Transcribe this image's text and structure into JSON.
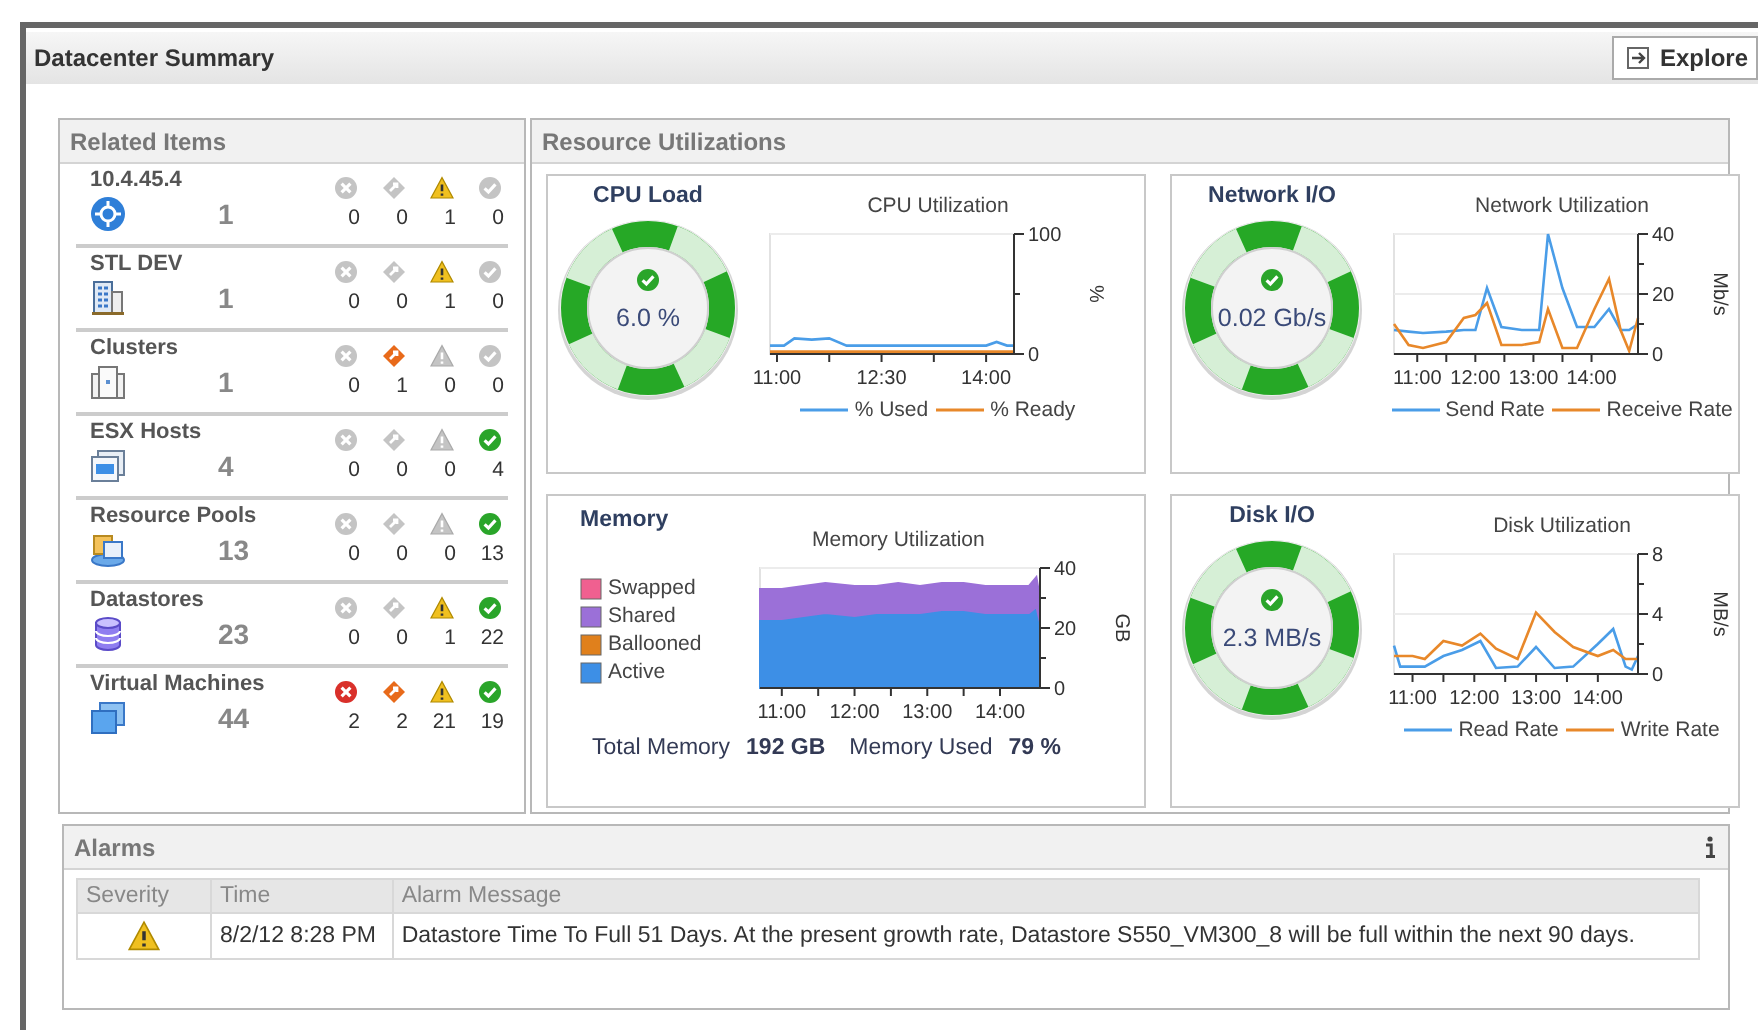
{
  "window": {
    "title": "Datacenter Summary"
  },
  "explore_button": {
    "label": "Explore"
  },
  "related_items": {
    "title": "Related Items",
    "items": [
      {
        "name": "10.4.45.4",
        "kind": "vcenter",
        "count": "1",
        "statuses": [
          {
            "kind": "critical",
            "count": "0",
            "active": false
          },
          {
            "kind": "major",
            "count": "0",
            "active": false
          },
          {
            "kind": "warning",
            "count": "1",
            "active": true
          },
          {
            "kind": "normal",
            "count": "0",
            "active": false
          }
        ]
      },
      {
        "name": "STL DEV",
        "kind": "datacenter",
        "count": "1",
        "statuses": [
          {
            "kind": "critical",
            "count": "0",
            "active": false
          },
          {
            "kind": "major",
            "count": "0",
            "active": false
          },
          {
            "kind": "warning",
            "count": "1",
            "active": true
          },
          {
            "kind": "normal",
            "count": "0",
            "active": false
          }
        ]
      },
      {
        "name": "Clusters",
        "kind": "cluster",
        "count": "1",
        "statuses": [
          {
            "kind": "critical",
            "count": "0",
            "active": false
          },
          {
            "kind": "major",
            "count": "1",
            "active": true
          },
          {
            "kind": "warning",
            "count": "0",
            "active": false
          },
          {
            "kind": "normal",
            "count": "0",
            "active": false
          }
        ]
      },
      {
        "name": "ESX Hosts",
        "kind": "host",
        "count": "4",
        "statuses": [
          {
            "kind": "critical",
            "count": "0",
            "active": false
          },
          {
            "kind": "major",
            "count": "0",
            "active": false
          },
          {
            "kind": "warning",
            "count": "0",
            "active": false
          },
          {
            "kind": "normal",
            "count": "4",
            "active": true
          }
        ]
      },
      {
        "name": "Resource Pools",
        "kind": "pool",
        "count": "13",
        "statuses": [
          {
            "kind": "critical",
            "count": "0",
            "active": false
          },
          {
            "kind": "major",
            "count": "0",
            "active": false
          },
          {
            "kind": "warning",
            "count": "0",
            "active": false
          },
          {
            "kind": "normal",
            "count": "13",
            "active": true
          }
        ]
      },
      {
        "name": "Datastores",
        "kind": "datastore",
        "count": "23",
        "statuses": [
          {
            "kind": "critical",
            "count": "0",
            "active": false
          },
          {
            "kind": "major",
            "count": "0",
            "active": false
          },
          {
            "kind": "warning",
            "count": "1",
            "active": true
          },
          {
            "kind": "normal",
            "count": "22",
            "active": true
          }
        ]
      },
      {
        "name": "Virtual Machines",
        "kind": "vm",
        "count": "44",
        "statuses": [
          {
            "kind": "critical",
            "count": "2",
            "active": true
          },
          {
            "kind": "major",
            "count": "2",
            "active": true
          },
          {
            "kind": "warning",
            "count": "21",
            "active": true
          },
          {
            "kind": "normal",
            "count": "19",
            "active": true
          }
        ]
      }
    ]
  },
  "resource_utilizations": {
    "title": "Resource Utilizations",
    "cards": [
      {
        "kind": "gauge",
        "title": "CPU Load",
        "value": "6.0 %",
        "healthy": true,
        "chart_data": {
          "type": "line",
          "title": "CPU Utilization",
          "ylabel": "%",
          "x": [
            10.9,
            11.1,
            11.25,
            11.5,
            11.75,
            12,
            12.5,
            13,
            13.5,
            14,
            14.15,
            14.3,
            14.4
          ],
          "xlim": [
            10.9,
            14.4
          ],
          "ylim": [
            0,
            100
          ],
          "xticks": [
            {
              "value": 11,
              "label": "11:00"
            },
            {
              "value": 12.5,
              "label": "12:30"
            },
            {
              "value": 14,
              "label": "14:00"
            }
          ],
          "yticks": [
            0,
            100
          ],
          "series": [
            {
              "name": "% Used",
              "color": "#4a9de8",
              "values": [
                7,
                7,
                13,
                12,
                13,
                7,
                7,
                7,
                7,
                7,
                10,
                7,
                7
              ]
            },
            {
              "name": "% Ready",
              "color": "#e8882a",
              "values": [
                2,
                2,
                2,
                2,
                2,
                2,
                2,
                2,
                2,
                2,
                2,
                2,
                2
              ]
            }
          ]
        }
      },
      {
        "kind": "gauge",
        "title": "Network I/O",
        "value": "0.02 Gb/s",
        "healthy": true,
        "chart_data": {
          "type": "line",
          "title": "Network Utilization",
          "ylabel": "Mb/s",
          "x": [
            10.6,
            10.85,
            11.1,
            11.5,
            11.8,
            12,
            12.2,
            12.45,
            12.8,
            13.1,
            13.25,
            13.5,
            13.75,
            14.05,
            14.3,
            14.5,
            14.65,
            14.8
          ],
          "xlim": [
            10.6,
            14.8
          ],
          "ylim": [
            0,
            40
          ],
          "xticks": [
            {
              "value": 11,
              "label": "11:00"
            },
            {
              "value": 12,
              "label": "12:00"
            },
            {
              "value": 13,
              "label": "13:00"
            },
            {
              "value": 14,
              "label": "14:00"
            }
          ],
          "yticks": [
            0,
            20,
            40
          ],
          "series": [
            {
              "name": "Send Rate",
              "color": "#4a9de8",
              "values": [
                8,
                7.5,
                7,
                7.5,
                8,
                8,
                22,
                9,
                8,
                8,
                40,
                22,
                9,
                9,
                15,
                8,
                8,
                10
              ]
            },
            {
              "name": "Receive Rate",
              "color": "#e8882a",
              "values": [
                10,
                3,
                2,
                4,
                12,
                13,
                17,
                3,
                3,
                4,
                15,
                2,
                2,
                15,
                25,
                8,
                1,
                12
              ]
            }
          ]
        }
      },
      {
        "kind": "memory",
        "title": "Memory",
        "chart_data": {
          "type": "area",
          "stacked": true,
          "title": "Memory Utilization",
          "ylabel": "GB",
          "x": [
            10.7,
            11,
            11.3,
            11.6,
            12,
            12.3,
            12.6,
            12.9,
            13.2,
            13.5,
            13.8,
            14.1,
            14.4,
            14.5,
            14.55
          ],
          "xlim": [
            10.7,
            14.55
          ],
          "ylim": [
            0,
            40
          ],
          "xticks": [
            {
              "value": 11,
              "label": "11:00"
            },
            {
              "value": 12,
              "label": "12:00"
            },
            {
              "value": 13,
              "label": "13:00"
            },
            {
              "value": 14,
              "label": "14:00"
            }
          ],
          "yticks": [
            0,
            20,
            40
          ],
          "series": [
            {
              "name": "Swapped",
              "color": "#f06090",
              "values": [
                null,
                null,
                null,
                null,
                null,
                null,
                null,
                null,
                null,
                null,
                null,
                null,
                null,
                null,
                null
              ]
            },
            {
              "name": "Shared",
              "color": "#9b70d8",
              "values": [
                10,
                10,
                10,
                10,
                10,
                9,
                10,
                9,
                9,
                9,
                9,
                9,
                9,
                10,
                8
              ]
            },
            {
              "name": "Ballooned",
              "color": "#e0801c",
              "values": [
                null,
                null,
                null,
                null,
                null,
                null,
                null,
                null,
                null,
                null,
                null,
                null,
                null,
                null,
                null
              ]
            },
            {
              "name": "Active",
              "color": "#3d8fe6",
              "values": [
                23,
                23,
                24,
                25,
                24,
                25,
                25,
                25,
                26,
                26,
                25,
                25,
                25,
                27,
                22
              ]
            }
          ]
        },
        "footer": [
          {
            "label": "Total Memory",
            "value": "192 GB"
          },
          {
            "label": "Memory Used",
            "value": "79 %"
          }
        ]
      },
      {
        "kind": "gauge",
        "title": "Disk I/O",
        "value": "2.3 MB/s",
        "healthy": true,
        "chart_data": {
          "type": "line",
          "title": "Disk Utilization",
          "ylabel": "MB/s",
          "x": [
            10.7,
            10.8,
            11.0,
            11.2,
            11.5,
            11.8,
            12.1,
            12.35,
            12.7,
            13.0,
            13.3,
            13.6,
            14.0,
            14.25,
            14.45,
            14.55,
            14.65
          ],
          "xlim": [
            10.7,
            14.65
          ],
          "ylim": [
            0,
            8
          ],
          "xticks": [
            {
              "value": 11,
              "label": "11:00"
            },
            {
              "value": 12,
              "label": "12:00"
            },
            {
              "value": 13,
              "label": "13:00"
            },
            {
              "value": 14,
              "label": "14:00"
            }
          ],
          "yticks": [
            0,
            4,
            8
          ],
          "series": [
            {
              "name": "Read Rate",
              "color": "#4a9de8",
              "values": [
                1.9,
                0.5,
                0.5,
                0.5,
                1.2,
                1.6,
                2.2,
                0.4,
                0.5,
                1.8,
                0.4,
                0.5,
                2.0,
                3.0,
                0.5,
                0.3,
                1.2
              ]
            },
            {
              "name": "Write Rate",
              "color": "#e8882a",
              "values": [
                1.2,
                1.2,
                1.2,
                1.0,
                2.2,
                1.9,
                2.7,
                1.7,
                1.0,
                4.1,
                2.8,
                1.8,
                1.2,
                1.6,
                1.0,
                1.0,
                1.0
              ]
            }
          ]
        }
      }
    ]
  },
  "alarms": {
    "title": "Alarms",
    "columns": [
      "Severity",
      "Time",
      "Alarm Message"
    ],
    "rows": [
      {
        "kind": "warning",
        "time": "8/2/12 8:28 PM",
        "message": "Datastore Time To Full 51 Days. At the present growth rate, Datastore S550_VM300_8 will be full within the next 90 days."
      }
    ]
  }
}
